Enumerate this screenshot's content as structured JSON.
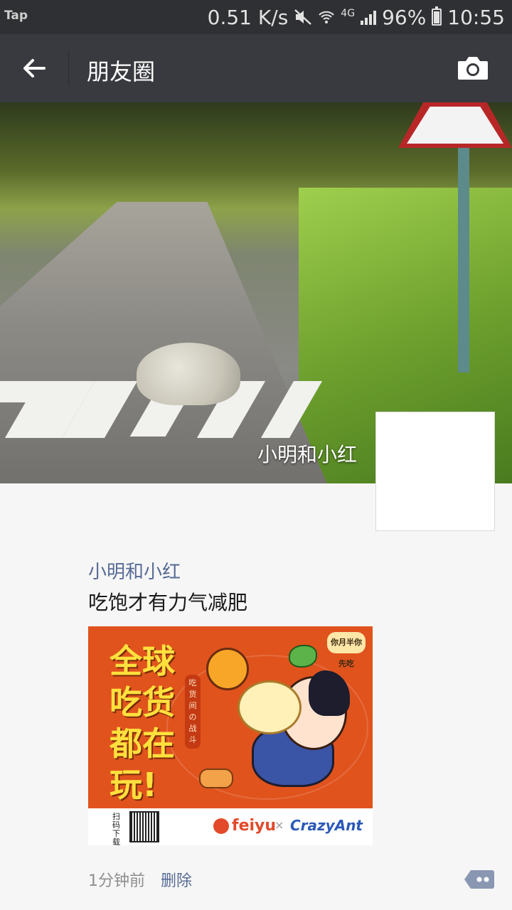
{
  "status_bar": {
    "carrier": "Tap",
    "speed": "0.51 K/s",
    "network": "4G",
    "battery": "96%",
    "time": "10:55"
  },
  "nav": {
    "title": "朋友圈",
    "back_icon": "arrow-left-icon",
    "camera_icon": "camera-icon"
  },
  "cover": {
    "nickname": "小明和小红"
  },
  "post": {
    "author": "小明和小红",
    "text": "吃饱才有力气减肥",
    "image": {
      "slogan": "全球吃货都在玩!",
      "vertical_text": "吃货间の战斗",
      "badge": "你月半你先吃",
      "qr_label": "扫码下载",
      "brand_1": "feiyu",
      "separator": "×",
      "brand_2": "CrazyAnt"
    },
    "time": "1分钟前",
    "delete_label": "删除",
    "comment_icon": "comment-more-icon"
  },
  "colors": {
    "nav_bg": "#393a3f",
    "status_bg": "#2f3033",
    "link": "#576b95",
    "page_bg": "#f6f6f6",
    "poster_bg": "#e0531d"
  }
}
